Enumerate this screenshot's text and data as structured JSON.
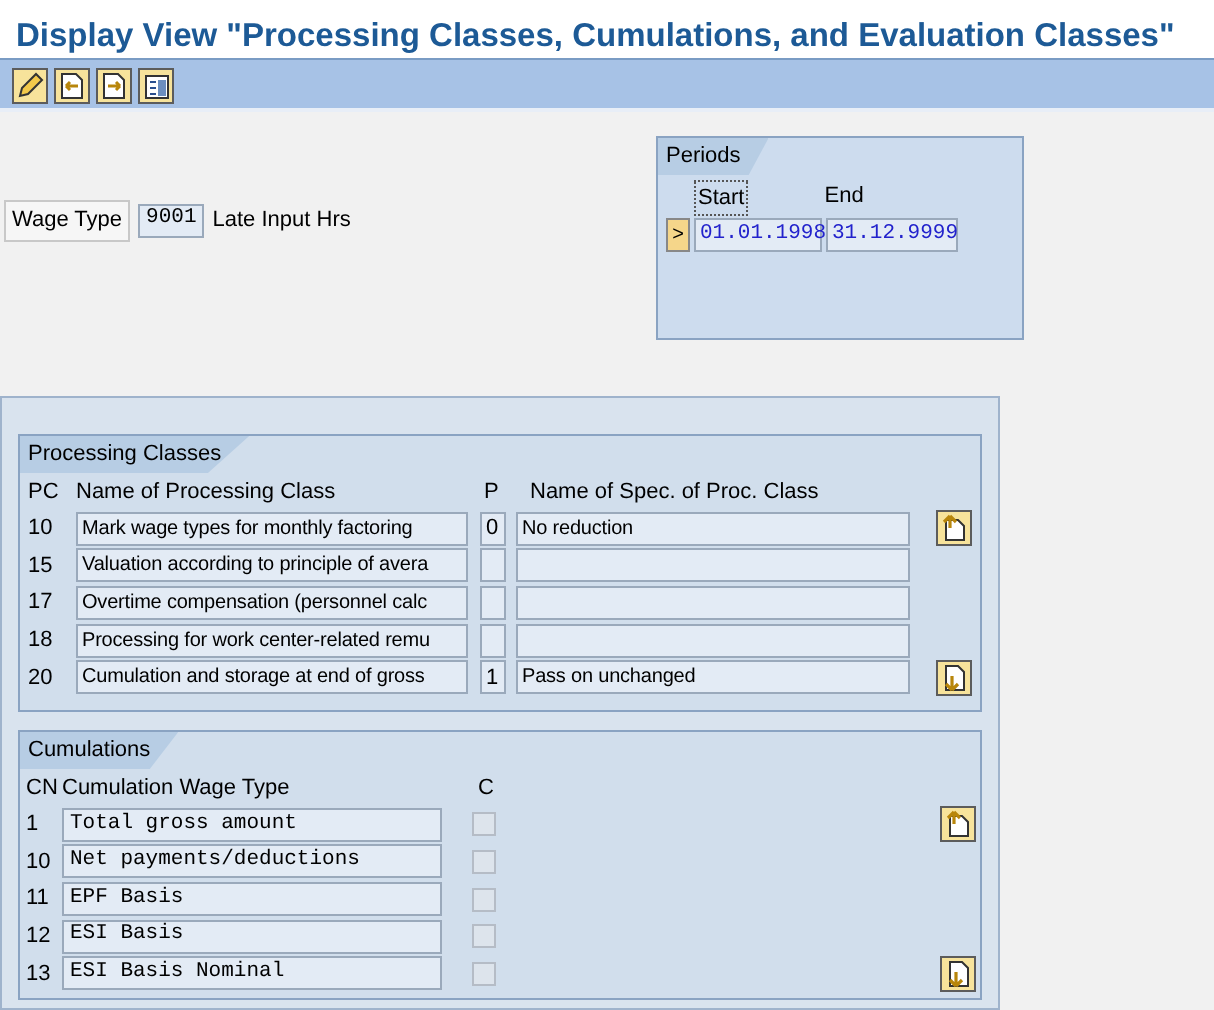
{
  "title": "Display View \"Processing Classes, Cumulations, and Evaluation Classes\"",
  "wage_type": {
    "label": "Wage Type",
    "value": "9001",
    "description": "Late Input Hrs"
  },
  "periods": {
    "title": "Periods",
    "columns": [
      "Start",
      "End"
    ],
    "rows": [
      {
        "marker": ">",
        "start": "01.01.1998",
        "end": "31.12.9999"
      }
    ]
  },
  "processing_classes": {
    "title": "Processing Classes",
    "columns": [
      "PC",
      "Name of Processing Class",
      "P",
      "Name of Spec. of Proc. Class"
    ],
    "rows": [
      {
        "pc": "10",
        "name": "Mark wage types for monthly factoring",
        "p": "0",
        "spec": "No reduction"
      },
      {
        "pc": "15",
        "name": "Valuation according to principle of avera"
      },
      {
        "pc": "17",
        "name": "Overtime compensation (personnel calc"
      },
      {
        "pc": "18",
        "name": "Processing for work center-related remu"
      },
      {
        "pc": "20",
        "name": "Cumulation and storage at end of gross",
        "p": "1",
        "spec": "Pass on unchanged"
      }
    ]
  },
  "cumulations": {
    "title": "Cumulations",
    "columns": [
      "CN",
      "Cumulation Wage Type",
      "C"
    ],
    "rows": [
      {
        "cn": "1",
        "name": "Total gross amount",
        "checked": false
      },
      {
        "cn": "10",
        "name": "Net payments/deductions",
        "checked": false
      },
      {
        "cn": "11",
        "name": "EPF Basis",
        "checked": false
      },
      {
        "cn": "12",
        "name": "ESI Basis",
        "checked": false
      },
      {
        "cn": "13",
        "name": "ESI Basis Nominal",
        "checked": false
      }
    ]
  }
}
